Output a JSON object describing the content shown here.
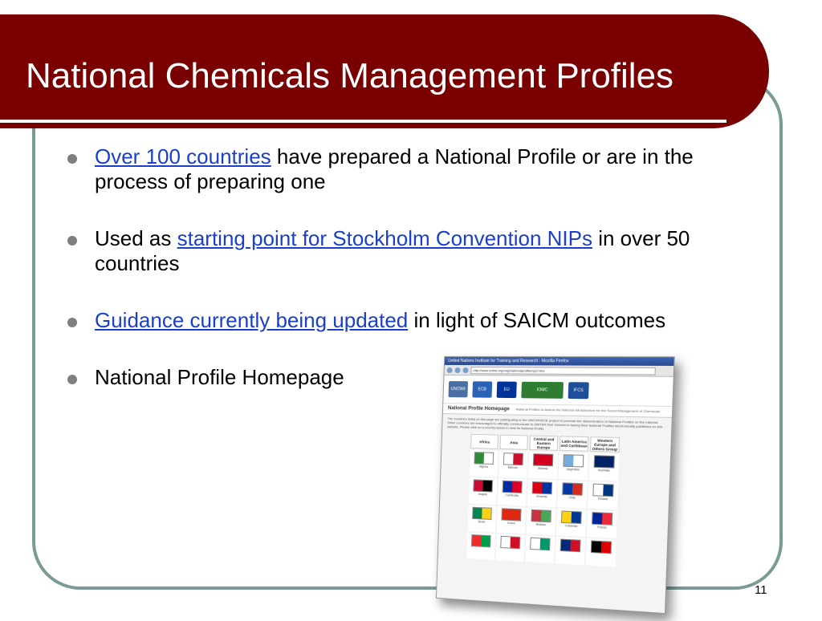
{
  "slide": {
    "title": "National Chemicals Management Profiles",
    "page_number": "11",
    "bullets": [
      {
        "link": "Over 100 countries",
        "text_after": " have prepared a National Profile or are in the process of preparing one"
      },
      {
        "text_before": "Used as ",
        "link": "starting point for Stockholm Convention NIPs",
        "text_after": " in over 50 countries"
      },
      {
        "link": "Guidance currently being updated",
        "text_after": " in light of SAICM outcomes"
      },
      {
        "text": "National Profile Homepage"
      }
    ]
  },
  "colors": {
    "title_bar": "#7a0000",
    "frame_border": "#7a9a95",
    "link": "#1a3fc8",
    "bullet_dot": "#7f7f7f"
  },
  "embedded_screenshot": {
    "window_title": "United Nations Institute for Training and Research - Mozilla Firefox",
    "address": "http://www.unitar.org/cwg/nationalprofile/np2.html",
    "logos": [
      "UNITAR",
      "ECB",
      "EU",
      "IOMC",
      "IFCS"
    ],
    "heading": "National Profile Homepage",
    "heading_sub": "National Profiles to Assess the National Infrastructure for the Sound Management of Chemicals",
    "paragraph": "The countries listed on this page are participating in the UNITAR/ECB project to promote the dissemination of National Profiles on the Internet. Other countries are encouraged to officially communicate to UNITAR their interest in having their National Profiles electronically published on this website. Please click on a country below to view its National Profile.",
    "columns": [
      "Africa",
      "Asia",
      "Central and Eastern Europe",
      "Latin America and Caribbean",
      "Western Europe and Others Group"
    ],
    "flag_rows": [
      [
        {
          "label": "Algeria",
          "colors": [
            "#2e8b3a",
            "#ffffff"
          ]
        },
        {
          "label": "Bahrain",
          "colors": [
            "#ffffff",
            "#c8102e"
          ]
        },
        {
          "label": "Albania",
          "colors": [
            "#d2001e",
            "#d2001e"
          ]
        },
        {
          "label": "Argentina",
          "colors": [
            "#74acdf",
            "#ffffff"
          ]
        },
        {
          "label": "Australia",
          "colors": [
            "#012169",
            "#012169"
          ]
        }
      ],
      [
        {
          "label": "Angola",
          "colors": [
            "#cc092f",
            "#000000"
          ]
        },
        {
          "label": "Cambodia",
          "colors": [
            "#032ea1",
            "#e00025"
          ]
        },
        {
          "label": "Armenia",
          "colors": [
            "#d90012",
            "#0033a0"
          ]
        },
        {
          "label": "Chile",
          "colors": [
            "#0039a6",
            "#d52b1e"
          ]
        },
        {
          "label": "Finland",
          "colors": [
            "#ffffff",
            "#003580"
          ]
        }
      ],
      [
        {
          "label": "Benin",
          "colors": [
            "#008751",
            "#fcd116"
          ]
        },
        {
          "label": "China",
          "colors": [
            "#de2910",
            "#de2910"
          ]
        },
        {
          "label": "Belarus",
          "colors": [
            "#c8313e",
            "#4aa657"
          ]
        },
        {
          "label": "Colombia",
          "colors": [
            "#fcd116",
            "#003893"
          ]
        },
        {
          "label": "France",
          "colors": [
            "#002395",
            "#ed2939"
          ]
        }
      ],
      [
        {
          "label": "",
          "colors": [
            "#ef2b2d",
            "#009e49"
          ]
        },
        {
          "label": "",
          "colors": [
            "#ffffff",
            "#ce1126"
          ]
        },
        {
          "label": "",
          "colors": [
            "#ffffff",
            "#00966e"
          ]
        },
        {
          "label": "",
          "colors": [
            "#002b7f",
            "#ce1126"
          ]
        },
        {
          "label": "",
          "colors": [
            "#000000",
            "#dd0000"
          ]
        }
      ]
    ]
  }
}
